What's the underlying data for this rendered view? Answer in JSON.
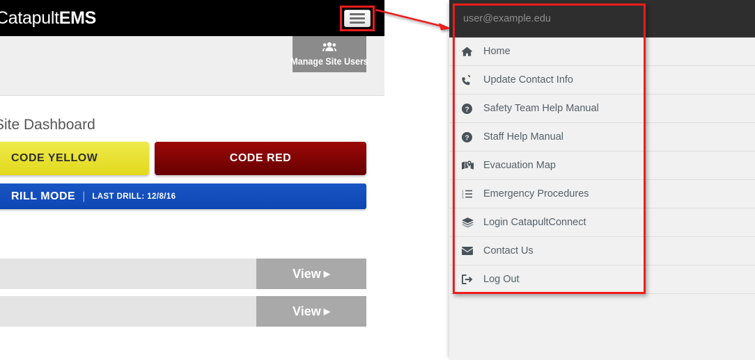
{
  "app": {
    "brand_light": "Catapult",
    "brand_bold": "EMS",
    "hamburger_icon": "hamburger-menu-icon"
  },
  "toolbar": {
    "manage_users_label": "Manage Site Users",
    "manage_users_icon": "users-icon"
  },
  "dashboard": {
    "title": "Site Dashboard",
    "code_yellow_label": "CODE YELLOW",
    "code_red_label": "CODE RED",
    "drill_mode_label": "RILL MODE",
    "drill_separator": "|",
    "last_drill_label": "LAST DRILL: 12/8/16",
    "rows": [
      {
        "view_label": "View",
        "caret": "▶"
      },
      {
        "view_label": "View",
        "caret": "▶"
      }
    ]
  },
  "menu": {
    "user_email": "user@example.edu",
    "items": [
      {
        "label": "Home",
        "icon": "home-icon"
      },
      {
        "label": "Update Contact Info",
        "icon": "phone-icon"
      },
      {
        "label": "Safety Team Help Manual",
        "icon": "question-circle-icon"
      },
      {
        "label": "Staff Help Manual",
        "icon": "question-circle-icon"
      },
      {
        "label": "Evacuation Map",
        "icon": "map-marked-icon"
      },
      {
        "label": "Emergency Procedures",
        "icon": "ordered-list-icon"
      },
      {
        "label": "Login CatapultConnect",
        "icon": "layer-group-icon"
      },
      {
        "label": "Contact Us",
        "icon": "envelope-icon"
      },
      {
        "label": "Log Out",
        "icon": "sign-out-icon"
      }
    ]
  },
  "annotations": {
    "arrow_color": "#ee1c1c",
    "highlight_color": "#ee1c1c"
  },
  "colors": {
    "header_black": "#000000",
    "code_yellow": "#e2d91d",
    "code_red": "#8a0606",
    "drill_blue": "#0d47b4",
    "gray_button": "#8b8b8b",
    "view_gray": "#a9a9a9",
    "menu_bg": "#f1f1f1",
    "menu_header_dark": "#2e2e2e"
  }
}
